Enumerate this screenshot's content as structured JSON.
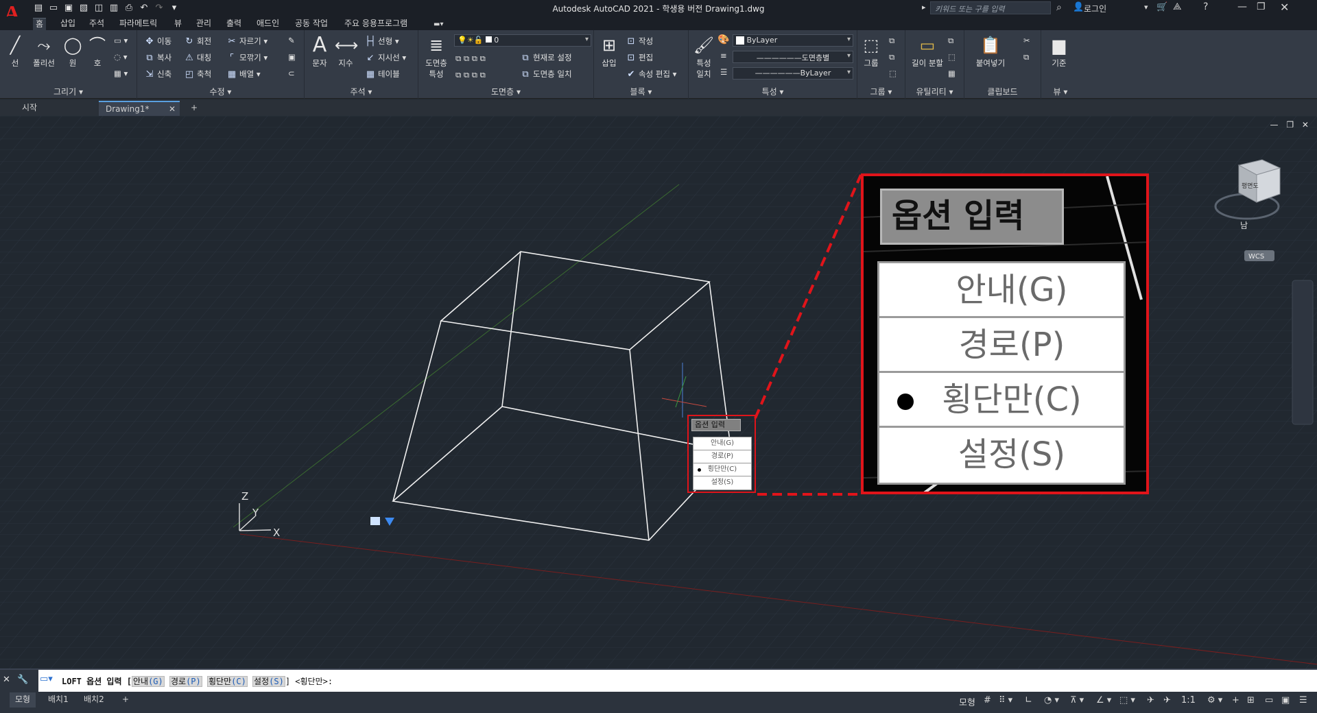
{
  "app": {
    "title": "Autodesk AutoCAD 2021 - 학생용 버전    Drawing1.dwg",
    "logo": "A",
    "search_placeholder": "키워드 또는 구를 입력",
    "login": "로그인"
  },
  "ribbon_tabs": [
    "홈",
    "삽입",
    "주석",
    "파라메트릭",
    "뷰",
    "관리",
    "출력",
    "애드인",
    "공동 작업",
    "주요 응용프로그램"
  ],
  "panels": {
    "draw": {
      "title": "그리기 ▾",
      "tools": [
        "선",
        "폴리선",
        "원",
        "호"
      ]
    },
    "modify": {
      "title": "수정 ▾",
      "tools": [
        "이동",
        "회전",
        "자르기",
        "복사",
        "대칭",
        "모깎기",
        "신축",
        "축척",
        "배열"
      ]
    },
    "annotation": {
      "title": "주석 ▾",
      "tools": [
        "문자",
        "지수",
        "선형",
        "지시선",
        "테이블"
      ]
    },
    "layers": {
      "title": "도면층 ▾",
      "big": "도면층 특성",
      "layer_value": "0",
      "tools": [
        "현재로 설정",
        "도면층 일치"
      ]
    },
    "block": {
      "title": "블록 ▾",
      "big": "삽입",
      "tools": [
        "작성",
        "편집",
        "속성 편집"
      ]
    },
    "properties": {
      "title": "특성 ▾",
      "big": "특성 일치",
      "color": "ByLayer",
      "linetype": "도면층별",
      "lineweight": "ByLayer"
    },
    "groups": {
      "title": "그룹 ▾",
      "big": "그룹"
    },
    "utilities": {
      "title": "유틸리티 ▾",
      "big": "길이 분할"
    },
    "clipboard": {
      "title": "클립보드",
      "big": "붙여넣기"
    },
    "view": {
      "title": "뷰 ▾",
      "big": "기준"
    }
  },
  "file_tabs": [
    "시작",
    "Drawing1*"
  ],
  "viewcube": {
    "face": "평면도",
    "south": "남",
    "wcs": "WCS"
  },
  "axis_labels": {
    "x": "X",
    "y": "Y",
    "z": "Z"
  },
  "tooltip": {
    "title": "옵션 입력",
    "items": [
      {
        "label": "안내(G)",
        "selected": false
      },
      {
        "label": "경로(P)",
        "selected": false
      },
      {
        "label": "횡단만(C)",
        "selected": true
      },
      {
        "label": "설정(S)",
        "selected": false
      }
    ]
  },
  "command_line": {
    "prefix": "LOFT 옵션 입력 [",
    "options": [
      {
        "text": "안내",
        "key": "(G)"
      },
      {
        "text": "경로",
        "key": "(P)"
      },
      {
        "text": "횡단만",
        "key": "(C)"
      },
      {
        "text": "설정",
        "key": "(S)"
      }
    ],
    "suffix": "] <횡단만>:"
  },
  "status": {
    "layout_tabs": [
      "모형",
      "배치1",
      "배치2"
    ],
    "model_label": "모형",
    "scale": "1:1"
  }
}
